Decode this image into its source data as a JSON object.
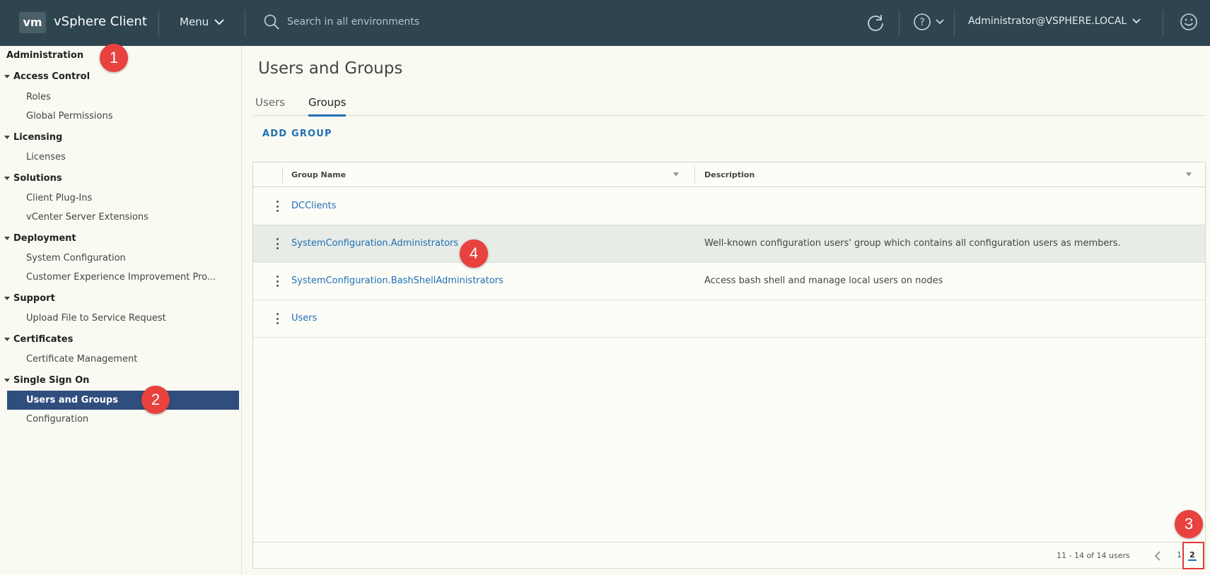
{
  "header": {
    "logo": "vm",
    "app_title": "vSphere Client",
    "menu_label": "Menu",
    "search_placeholder": "Search in all environments",
    "user": "Administrator@VSPHERE.LOCAL",
    "icons": [
      "refresh-icon",
      "help-icon",
      "smiley-icon"
    ]
  },
  "sidebar": {
    "title": "Administration",
    "groups": [
      {
        "label": "Access Control",
        "items": [
          "Roles",
          "Global Permissions"
        ]
      },
      {
        "label": "Licensing",
        "items": [
          "Licenses"
        ]
      },
      {
        "label": "Solutions",
        "items": [
          "Client Plug-Ins",
          "vCenter Server Extensions"
        ]
      },
      {
        "label": "Deployment",
        "items": [
          "System Configuration",
          "Customer Experience Improvement Pro..."
        ]
      },
      {
        "label": "Support",
        "items": [
          "Upload File to Service Request"
        ]
      },
      {
        "label": "Certificates",
        "items": [
          "Certificate Management"
        ]
      },
      {
        "label": "Single Sign On",
        "items": [
          "Users and Groups",
          "Configuration"
        ]
      }
    ],
    "active_item": "Users and Groups"
  },
  "main": {
    "title": "Users and Groups",
    "tabs": [
      {
        "label": "Users"
      },
      {
        "label": "Groups"
      }
    ],
    "active_tab": "Groups",
    "add_button": "ADD GROUP",
    "columns": {
      "name": "Group Name",
      "description": "Description"
    },
    "rows": [
      {
        "name": "DCClients",
        "description": ""
      },
      {
        "name": "SystemConfiguration.Administrators",
        "description": "Well-known configuration users' group which contains all configuration users as members."
      },
      {
        "name": "SystemConfiguration.BashShellAdministrators",
        "description": "Access bash shell and manage local users on nodes"
      },
      {
        "name": "Users",
        "description": ""
      }
    ],
    "footer": {
      "count": "11 - 14 of 14 users",
      "pages": [
        "1",
        "2"
      ],
      "current_page": "2"
    }
  },
  "annotations": [
    "1",
    "2",
    "3",
    "4"
  ],
  "colors": {
    "header_bg": "#2e4550",
    "active_bg": "#2f4e7e",
    "link": "#1f6fb4",
    "callout": "#e8413e"
  }
}
